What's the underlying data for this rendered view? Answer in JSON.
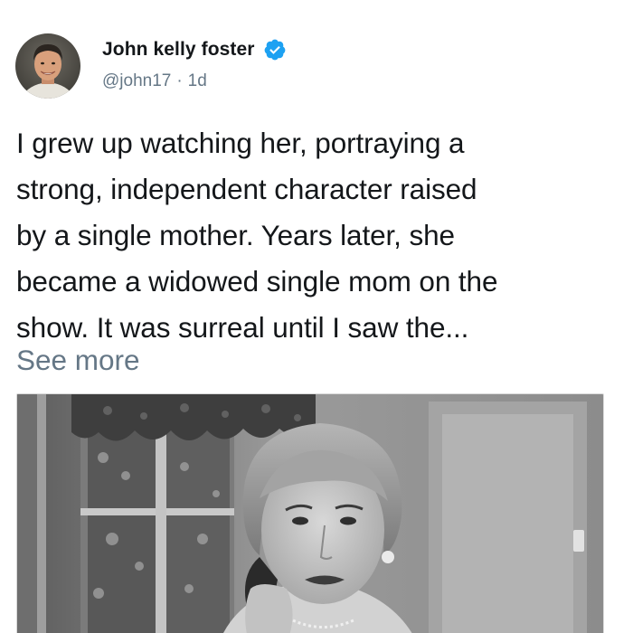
{
  "tweet": {
    "author": {
      "display_name": "John kelly foster",
      "handle": "@john17",
      "verified": true,
      "avatar_icon": "profile-photo"
    },
    "separator": "·",
    "timestamp": "1d",
    "text_lines": [
      "I grew up watching her, portraying a",
      "strong, independent character raised",
      "by a single mother. Years later, she",
      "became a widowed single mom on the",
      "show. It was surreal until I saw the..."
    ],
    "see_more_label": "See more",
    "media": {
      "type": "photo",
      "style": "black-and-white still"
    }
  },
  "colors": {
    "text_primary": "#14171a",
    "text_secondary": "#657786",
    "verified_blue": "#1da1f2",
    "background": "#ffffff"
  }
}
